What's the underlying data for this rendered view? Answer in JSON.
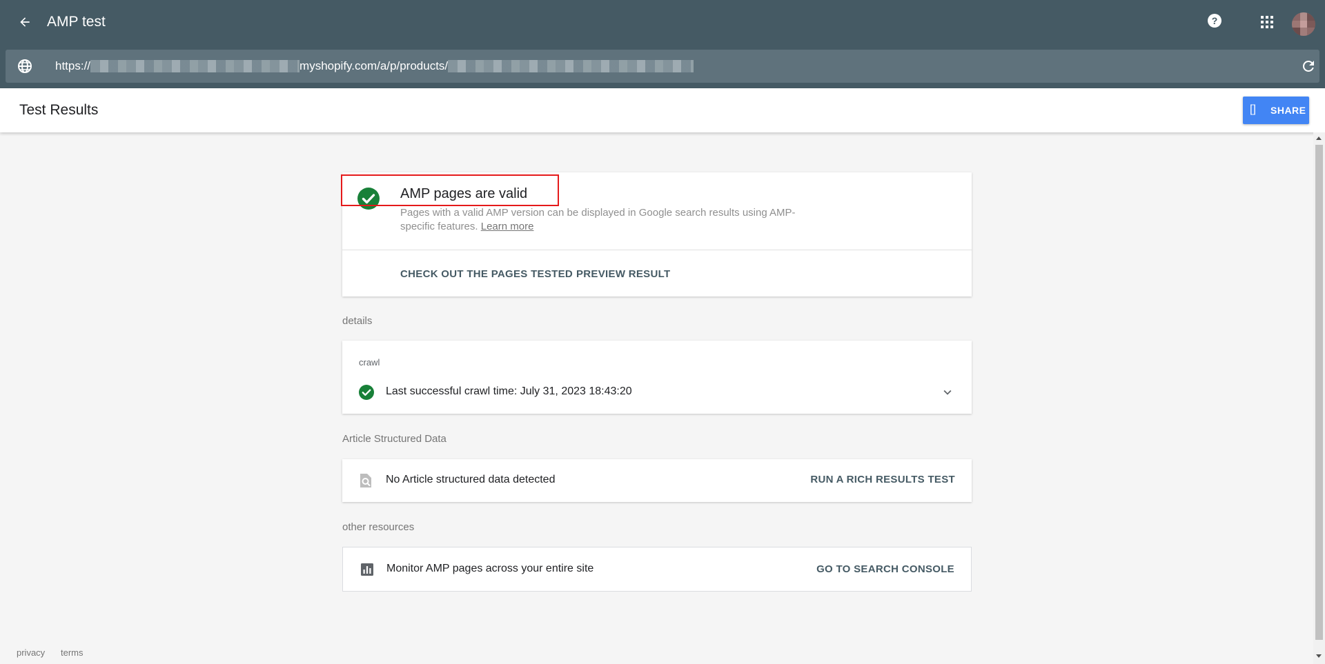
{
  "appbar": {
    "title": "AMP test",
    "url_prefix": "https://",
    "url_middle": "myshopify.com/a/p/products/"
  },
  "header": {
    "title": "Test Results",
    "share_icon": "[]",
    "share_label": "SHARE"
  },
  "verdict": {
    "title": "AMP pages are valid",
    "description": "Pages with a valid AMP version can be displayed in Google search results using AMP-specific features.",
    "learn_more": "Learn more",
    "check_pages": "CHECK OUT THE PAGES TESTED",
    "preview": "PREVIEW RESULT"
  },
  "details": {
    "label": "details",
    "crawl_label": "crawl",
    "crawl_text": "Last successful crawl time: July 31, 2023 18:43:20"
  },
  "article": {
    "label": "Article Structured Data",
    "text": "No Article structured data detected",
    "action": "RUN A RICH RESULTS TEST"
  },
  "resources": {
    "label": "other resources",
    "text": "Monitor AMP pages across your entire site",
    "action": "GO TO SEARCH CONSOLE"
  },
  "footer": {
    "privacy": "privacy",
    "terms": "terms"
  },
  "colors": {
    "appbar": "#455a64",
    "success_green": "#188038",
    "share_blue": "#4285f4",
    "highlight_red": "#e5191a"
  }
}
